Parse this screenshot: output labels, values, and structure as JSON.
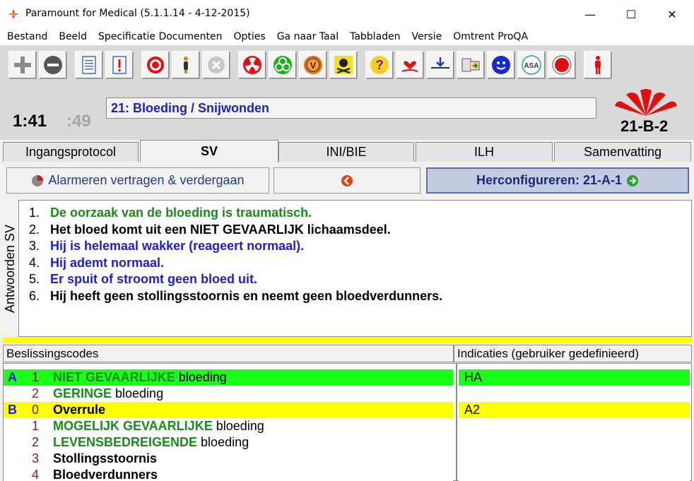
{
  "window": {
    "title": "Paramount for Medical (5.1.1.14 - 4-12-2015)",
    "controls": {
      "minimize": "—",
      "maximize": "☐",
      "close": "✕"
    }
  },
  "menu": [
    "Bestand",
    "Beeld",
    "Specificatie Documenten",
    "Opties",
    "Ga naar Taal",
    "Tabbladen",
    "Versie",
    "Omtrent ProQA"
  ],
  "toolbar": {
    "icons": [
      "plus-icon",
      "minus-icon",
      "document-icon",
      "alert-document-icon",
      "lifebuoy-icon",
      "person-icon",
      "cancel-icon",
      "radiation-icon",
      "biohazard-icon",
      "v-badge-icon",
      "skull-icon",
      "question-icon",
      "heart-hands-icon",
      "arrow-down-icon",
      "translate-icon",
      "smiley-icon",
      "asa-icon",
      "stop-icon",
      "standing-person-icon"
    ],
    "asa_text": "ASA",
    "v_text": "V",
    "question_text": "?"
  },
  "header": {
    "timer": "1:41",
    "timer_sub": ":49",
    "protocol": "21:  Bloeding / Snijwonden",
    "determinant_code": "21-B-2"
  },
  "tabs": [
    "Ingangsprotocol",
    "SV",
    "INI/BIE",
    "ILH",
    "Samenvatting"
  ],
  "actions": {
    "delay": "Alarmeren vertragen & verdergaan",
    "reconfigure": "Herconfigureren: 21-A-1"
  },
  "answers": {
    "side_label": "Antwoorden SV",
    "items": [
      {
        "n": "1.",
        "text": "De oorzaak van de bloeding is traumatisch.",
        "color": "#1a8a1a"
      },
      {
        "n": "2.",
        "text": "Het bloed komt uit een NIET GEVAARLIJK lichaamsdeel.",
        "color": "#000000"
      },
      {
        "n": "3.",
        "text": "Hij is helemaal wakker (reageert normaal).",
        "color": "#1f1fc8"
      },
      {
        "n": "4.",
        "text": "Hij ademt normaal.",
        "color": "#1f1fc8"
      },
      {
        "n": "5.",
        "text": "Er spuit of stroomt geen bloed uit.",
        "color": "#1f1fc8"
      },
      {
        "n": "6.",
        "text": "Hij heeft geen stollingsstoornis en neemt geen bloedverdunners.",
        "color": "#000000"
      }
    ]
  },
  "grid": {
    "headers": [
      "Beslissingscodes",
      "Indicaties (gebruiker gedefinieerd)"
    ],
    "rows": [
      {
        "level": "A",
        "num": "1",
        "strong": "NIET GEVAARLIJKE",
        "rest": " bloeding",
        "indication": "HA",
        "bg": "#1aff1a",
        "strong_class": "g"
      },
      {
        "level": "",
        "num": "2",
        "strong": "GERINGE",
        "rest": " bloeding",
        "indication": "",
        "bg": "#ffffff",
        "strong_class": "g"
      },
      {
        "level": "B",
        "num": "0",
        "strong": "Overrule",
        "rest": "",
        "indication": "A2",
        "bg": "#ffff00",
        "strong_class": "b"
      },
      {
        "level": "",
        "num": "1",
        "strong": "MOGELIJK GEVAARLIJKE",
        "rest": " bloeding",
        "indication": "",
        "bg": "#ffffff",
        "strong_class": "g"
      },
      {
        "level": "",
        "num": "2",
        "strong": "LEVENSBEDREIGENDE",
        "rest": " bloeding",
        "indication": "",
        "bg": "#ffffff",
        "strong_class": "g"
      },
      {
        "level": "",
        "num": "3",
        "strong": "Stollingsstoornis",
        "rest": "",
        "indication": "",
        "bg": "#ffffff",
        "strong_class": "b"
      },
      {
        "level": "",
        "num": "4",
        "strong": "Bloedverdunners",
        "rest": "",
        "indication": "",
        "bg": "#ffffff",
        "strong_class": "b"
      }
    ]
  }
}
